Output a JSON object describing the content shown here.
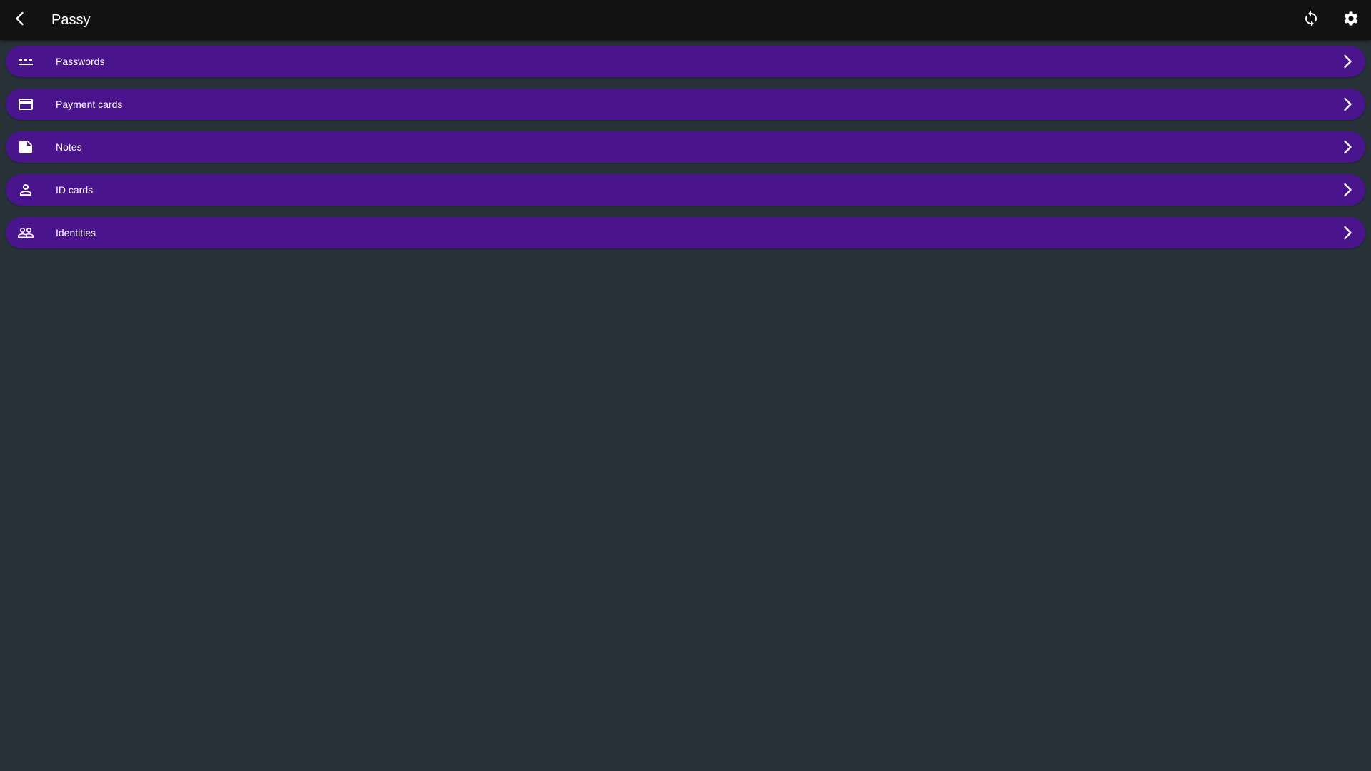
{
  "app": {
    "title": "Passy"
  },
  "toolbar": {
    "back_icon": "chevron-left-icon",
    "sync_icon": "sync-icon",
    "settings_icon": "gear-icon"
  },
  "colors": {
    "appbar": "#121212",
    "background": "#263238",
    "row": "#4a148c",
    "text": "#ffffff"
  },
  "categories": [
    {
      "label": "Passwords",
      "icon": "password-dots-icon"
    },
    {
      "label": "Payment cards",
      "icon": "credit-card-icon"
    },
    {
      "label": "Notes",
      "icon": "note-icon"
    },
    {
      "label": "ID cards",
      "icon": "person-icon"
    },
    {
      "label": "Identities",
      "icon": "people-icon"
    }
  ]
}
